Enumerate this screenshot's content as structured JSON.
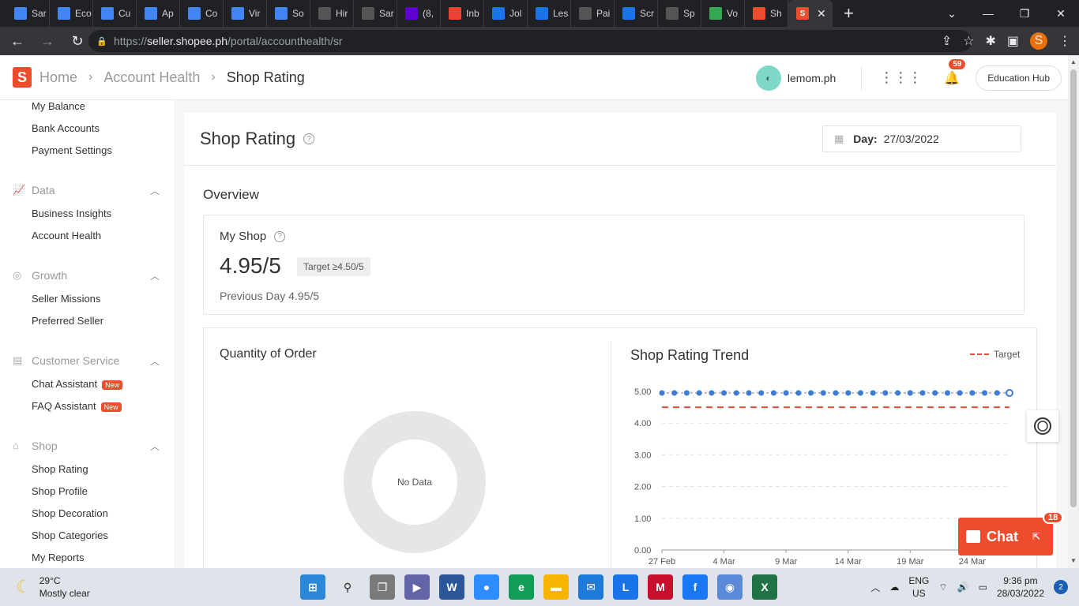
{
  "browser": {
    "tabs": [
      {
        "title": "Sar",
        "color": "#4285f4"
      },
      {
        "title": "Eco",
        "color": "#4285f4"
      },
      {
        "title": "Cu",
        "color": "#4285f4"
      },
      {
        "title": "Ap",
        "color": "#4285f4"
      },
      {
        "title": "Co",
        "color": "#4285f4"
      },
      {
        "title": "Vir",
        "color": "#4285f4"
      },
      {
        "title": "So",
        "color": "#4285f4"
      },
      {
        "title": "Hir",
        "color": "#555555"
      },
      {
        "title": "Sar",
        "color": "#555555"
      },
      {
        "title": "(8,",
        "color": "#6001d2"
      },
      {
        "title": "Inb",
        "color": "#ea4335"
      },
      {
        "title": "Jol",
        "color": "#1a73e8"
      },
      {
        "title": "Les",
        "color": "#1a73e8"
      },
      {
        "title": "Pai",
        "color": "#555555"
      },
      {
        "title": "Scr",
        "color": "#1a73e8"
      },
      {
        "title": "Sp",
        "color": "#555555"
      },
      {
        "title": "Vo",
        "color": "#34a853"
      },
      {
        "title": "Sh",
        "color": "#ee4d2d"
      }
    ],
    "url_prefix": "https://",
    "url_host": "seller.shopee.ph",
    "url_path": "/portal/accounthealth/sr",
    "profile_letter": "S"
  },
  "header": {
    "logo": "S",
    "breadcrumb": [
      "Home",
      "Account Health",
      "Shop Rating"
    ],
    "username": "lemom.ph",
    "notification_count": "59",
    "education_hub": "Education Hub"
  },
  "sidebar": {
    "finance_items": [
      "My Balance",
      "Bank Accounts",
      "Payment Settings"
    ],
    "data_label": "Data",
    "data_items": [
      "Business Insights",
      "Account Health"
    ],
    "growth_label": "Growth",
    "growth_items": [
      "Seller Missions",
      "Preferred Seller"
    ],
    "cs_label": "Customer Service",
    "cs_items": [
      "Chat Assistant",
      "FAQ Assistant"
    ],
    "new_tag": "New",
    "shop_label": "Shop",
    "shop_items": [
      "Shop Rating",
      "Shop Profile",
      "Shop Decoration",
      "Shop Categories",
      "My Reports"
    ]
  },
  "main": {
    "title": "Shop Rating",
    "day_label": "Day:",
    "day_value": "27/03/2022",
    "overview": "Overview",
    "my_shop": "My Shop",
    "score": "4.95/5",
    "target": "Target ≥4.50/5",
    "previous": "Previous Day 4.95/5",
    "qty_title": "Quantity of Order",
    "no_data": "No Data",
    "trend_title": "Shop Rating Trend",
    "legend_target": "Target"
  },
  "chart_data": {
    "type": "line",
    "title": "Shop Rating Trend",
    "x_ticks": [
      "27 Feb",
      "4 Mar",
      "9 Mar",
      "14 Mar",
      "19 Mar",
      "24 Mar"
    ],
    "y_ticks": [
      "0.00",
      "1.00",
      "2.00",
      "3.00",
      "4.00",
      "5.00"
    ],
    "ylim": [
      0,
      5
    ],
    "point_count": 29,
    "series": [
      {
        "values": [
          4.95,
          4.95,
          4.95,
          4.95,
          4.95,
          4.95,
          4.95,
          4.95,
          4.95,
          4.95,
          4.95,
          4.95,
          4.95,
          4.95,
          4.95,
          4.95,
          4.95,
          4.95,
          4.95,
          4.95,
          4.95,
          4.95,
          4.95,
          4.95,
          4.95,
          4.95,
          4.95,
          4.95,
          4.95
        ],
        "color": "#3a7bd5"
      }
    ],
    "target_value": 4.5,
    "target_color": "#e74c3c",
    "grid": true
  },
  "floating": {
    "chat_label": "Chat",
    "chat_badge": "18"
  },
  "taskbar": {
    "temp": "29°C",
    "condition": "Mostly clear",
    "lang_1": "ENG",
    "lang_2": "US",
    "time": "9:36 pm",
    "date": "28/03/2022",
    "notif_count": "2"
  }
}
